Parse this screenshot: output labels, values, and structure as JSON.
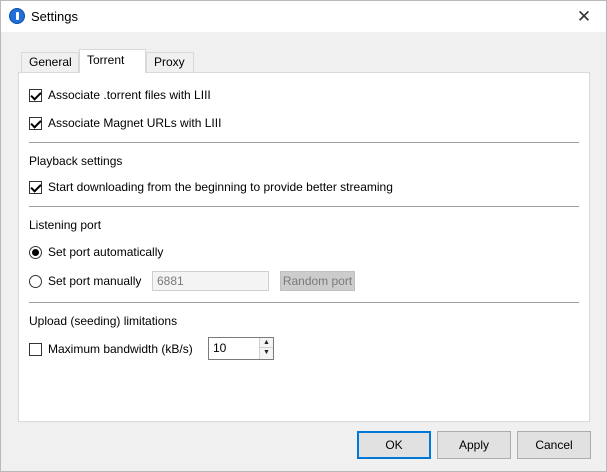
{
  "window": {
    "title": "Settings",
    "close_glyph": "✕"
  },
  "tabs": [
    {
      "label": "General"
    },
    {
      "label": "Torrent"
    },
    {
      "label": "Proxy"
    }
  ],
  "torrent": {
    "assoc_torrent": {
      "label": "Associate .torrent files with LIII",
      "checked": true
    },
    "assoc_magnet": {
      "label": "Associate Magnet URLs with LIII",
      "checked": true
    },
    "playback": {
      "heading": "Playback settings",
      "start_begin": {
        "label": "Start downloading from the beginning to provide better streaming",
        "checked": true
      }
    },
    "listening": {
      "heading": "Listening port",
      "auto": {
        "label": "Set port automatically",
        "checked": true
      },
      "manual": {
        "label": "Set port manually",
        "checked": false
      },
      "port_value": "6881",
      "random_port_label": "Random port"
    },
    "upload": {
      "heading": "Upload (seeding) limitations",
      "max_bw": {
        "label": "Maximum bandwidth (kB/s)",
        "checked": false
      },
      "bw_value": "10"
    }
  },
  "buttons": {
    "ok": "OK",
    "apply": "Apply",
    "cancel": "Cancel"
  }
}
